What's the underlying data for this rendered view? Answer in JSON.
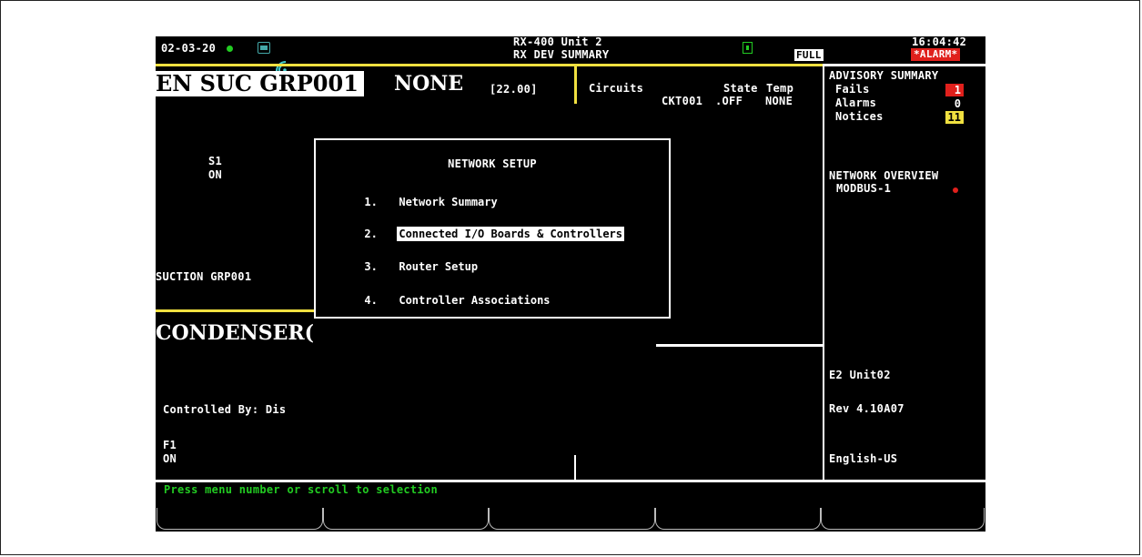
{
  "header": {
    "date": "02-03-20",
    "controller_name": "RX-400 Unit 2",
    "screen_title": "RX DEV SUMMARY",
    "mode_badge": "FULL",
    "time": "16:04:42",
    "alarm_label": "*ALARM*"
  },
  "suction_group": {
    "title": "EN SUC GRP001",
    "status_box": "NONE",
    "value": "[22.00]",
    "stage_label": "S1",
    "stage_state": "ON",
    "footer_name": "SUCTION GRP001"
  },
  "circuits": {
    "headers": [
      "Circuits",
      "State",
      "Temp"
    ],
    "rows": [
      {
        "name": "CKT001",
        "state": ".OFF",
        "temp": "NONE"
      }
    ]
  },
  "advisory_summary": {
    "title": "ADVISORY SUMMARY",
    "items": [
      {
        "label": "Fails",
        "count": "1",
        "color": "#e0201c"
      },
      {
        "label": "Alarms",
        "count": "0",
        "color": "#000000"
      },
      {
        "label": "Notices",
        "count": "11",
        "color": "#f0e040"
      }
    ]
  },
  "network_overview": {
    "title": "NETWORK OVERVIEW",
    "items": [
      {
        "label": "MODBUS-1",
        "status_color": "#e0201c"
      }
    ]
  },
  "condenser": {
    "title": "CONDENSER(",
    "controlled_by": "Controlled By: Dis",
    "fan_label": "F1",
    "fan_state": "ON"
  },
  "unit_info": {
    "name": "E2 Unit02",
    "revision": "Rev 4.10A07",
    "language": "English-US"
  },
  "network_setup_menu": {
    "title": "NETWORK SETUP",
    "items": [
      {
        "number": "1.",
        "label": "Network Summary"
      },
      {
        "number": "2.",
        "label": "Connected I/O Boards & Controllers",
        "selected": true
      },
      {
        "number": "3.",
        "label": "Router Setup"
      },
      {
        "number": "4.",
        "label": "Controller Associations"
      }
    ]
  },
  "status_bar": {
    "message": "Press menu number or scroll to selection"
  },
  "icons": [
    "status-dot-icon",
    "network-icon",
    "terminal-icon",
    "green-indicator-icon"
  ],
  "colors": {
    "accent_yellow": "#f0e040",
    "alarm_red": "#e0201c",
    "status_green": "#22cc22",
    "header_text": "#ffffff"
  }
}
